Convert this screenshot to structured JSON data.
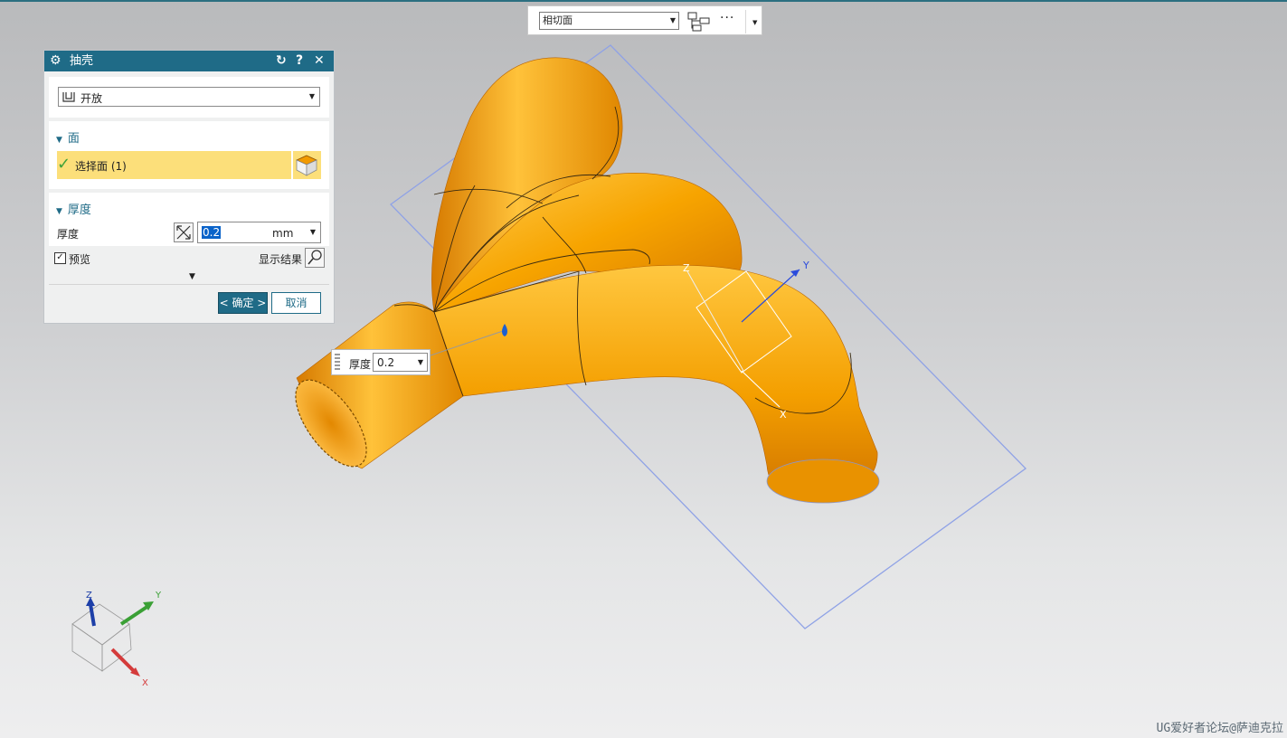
{
  "selection_toolbar": {
    "filter_value": "相切面",
    "more_label": "···"
  },
  "dialog": {
    "title": "抽壳",
    "type_value": "开放",
    "face_section_title": "面",
    "select_face_label": "选择面 (1)",
    "thickness_section_title": "厚度",
    "thickness_label": "厚度",
    "thickness_value": "0.2",
    "thickness_unit": "mm",
    "preview_label": "预览",
    "preview_checked": true,
    "show_result_label": "显示结果",
    "ok_label": "< 确定 >",
    "cancel_label": "取消"
  },
  "onscreen_input": {
    "label": "厚度",
    "value": "0.2"
  },
  "csys_labels": {
    "x": "X",
    "y": "Y",
    "z": "Z"
  },
  "watermark": "UG爱好者论坛@萨迪克拉",
  "colors": {
    "title_bar": "#1f6b87",
    "selection_highlight": "#fcdf7a",
    "part_orange": "#f5a000",
    "plane_blue": "#8fa2e6"
  },
  "icons": [
    "gear-icon",
    "reset-icon",
    "help-icon",
    "close-icon",
    "open-shell-icon",
    "check-icon",
    "cube-icon",
    "thickness-reverse-icon",
    "magnifier-icon",
    "tree-icon"
  ]
}
